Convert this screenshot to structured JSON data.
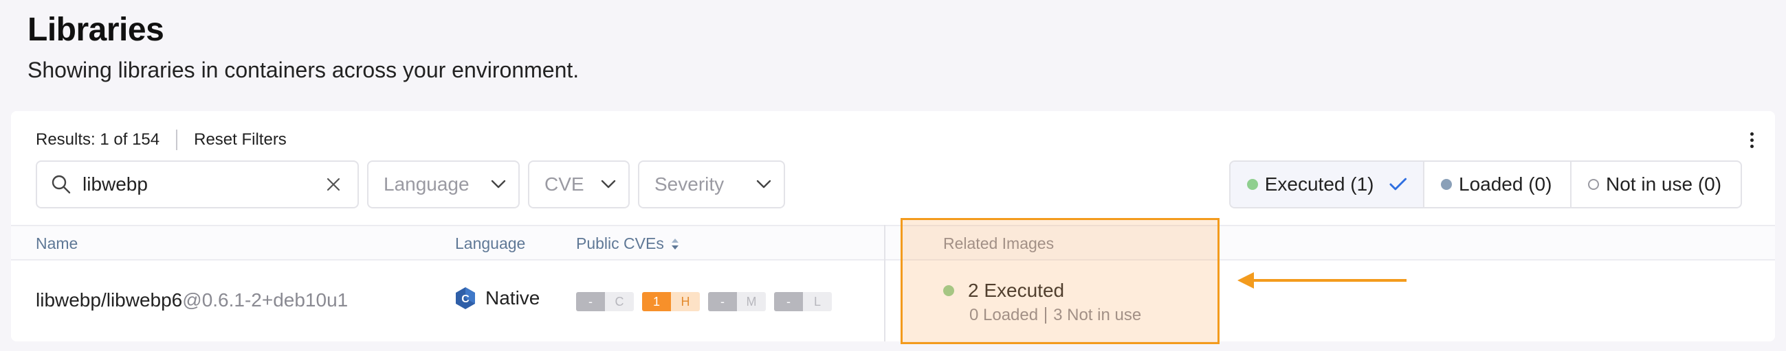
{
  "header": {
    "title": "Libraries",
    "subtitle": "Showing libraries in containers across your environment."
  },
  "toolbar": {
    "results_text": "Results: 1 of 154",
    "reset_label": "Reset Filters"
  },
  "filters": {
    "search_value": "libwebp",
    "language_placeholder": "Language",
    "cve_placeholder": "CVE",
    "severity_placeholder": "Severity"
  },
  "status_toggles": [
    {
      "label": "Executed (1)",
      "state": "selected",
      "dot_color": "#8fcf8f"
    },
    {
      "label": "Loaded (0)",
      "dot_color": "#8aa0b8"
    },
    {
      "label": "Not in use (0)",
      "dot_color": "hollow"
    }
  ],
  "table": {
    "columns": [
      "Name",
      "Language",
      "Public CVEs",
      "Related Images"
    ],
    "rows": [
      {
        "name": "libwebp/libwebp6",
        "version": "@0.6.1-2+deb10u1",
        "language": "Native",
        "language_icon": "native-language-icon",
        "cves": [
          {
            "count": "-",
            "level": "C"
          },
          {
            "count": "1",
            "level": "H"
          },
          {
            "count": "-",
            "level": "M"
          },
          {
            "count": "-",
            "level": "L"
          }
        ],
        "related_images": {
          "executed": "2 Executed",
          "loaded": "0 Loaded",
          "not_in_use": "3 Not in use"
        }
      }
    ]
  },
  "colors": {
    "highlight": "#f39b1d",
    "cve_high": "#f7902a",
    "header_text": "#5f7896",
    "accent_check": "#2f6fe0"
  }
}
